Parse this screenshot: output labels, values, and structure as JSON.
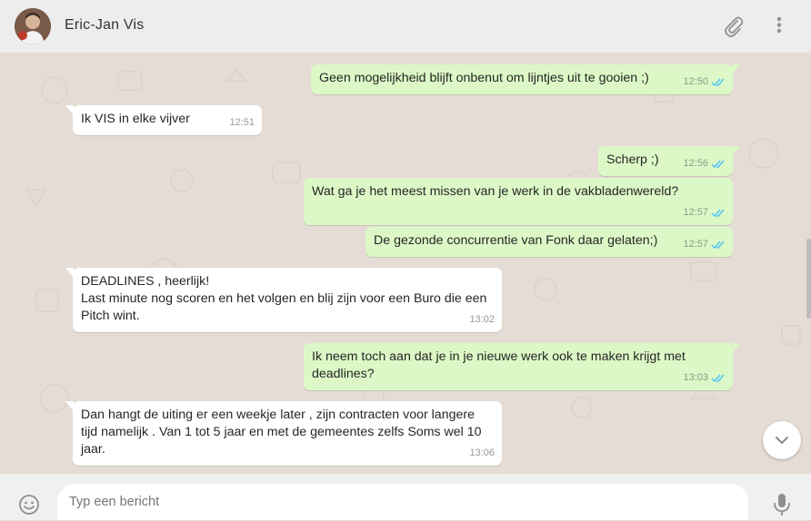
{
  "header": {
    "contact_name": "Eric-Jan Vis",
    "attach_icon": "paperclip-icon",
    "menu_icon": "kebab-menu-icon"
  },
  "colors": {
    "outgoing_bubble": "#dcf8c6",
    "incoming_bubble": "#ffffff",
    "read_tick": "#4fc3f7",
    "chat_background": "#e5ddd5"
  },
  "messages": [
    {
      "direction": "out",
      "text": "Geen mogelijkheid blijft onbenut om lijntjes uit te gooien ;)",
      "time": "12:50",
      "read": true
    },
    {
      "direction": "in",
      "text": "Ik VIS in elke vijver",
      "time": "12:51"
    },
    {
      "direction": "out",
      "text": "Scherp ;)",
      "time": "12:56",
      "read": true
    },
    {
      "direction": "out",
      "text": "Wat ga je het meest missen van je werk in de vakbladenwereld?",
      "time": "12:57",
      "read": true
    },
    {
      "direction": "out",
      "text": "De gezonde concurrentie van Fonk daar gelaten;)",
      "time": "12:57",
      "read": true
    },
    {
      "direction": "in",
      "text": "DEADLINES , heerlijk!\nLast minute nog scoren en het volgen en blij zijn voor een Buro die een Pitch wint.",
      "time": "13:02"
    },
    {
      "direction": "out",
      "text": "Ik neem toch aan dat je in je nieuwe werk ook te maken krijgt met deadlines?",
      "time": "13:03",
      "read": true
    },
    {
      "direction": "in",
      "text": "Dan hangt de uiting er een weekje later , zijn contracten voor langere tijd namelijk . Van 1 tot 5 jaar en met de gemeentes zelfs Soms wel 10 jaar.",
      "time": "13:06"
    }
  ],
  "composer": {
    "placeholder": "Typ een bericht",
    "emoji_icon": "smiley-icon",
    "mic_icon": "microphone-icon"
  },
  "scroll_down_icon": "chevron-down-icon"
}
